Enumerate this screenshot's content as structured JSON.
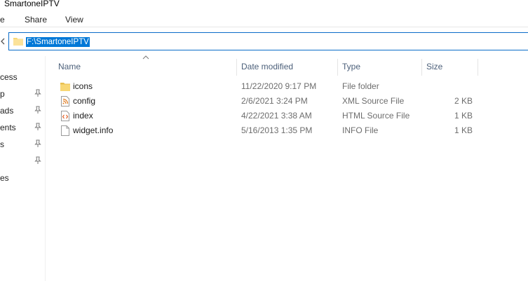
{
  "window": {
    "title": "SmartoneIPTV"
  },
  "ribbon": {
    "tabs": [
      "e",
      "Share",
      "View"
    ]
  },
  "address": {
    "path": "F:\\SmartoneIPTV"
  },
  "nav": {
    "items": [
      {
        "label": "cess",
        "pinned": false
      },
      {
        "label": "p",
        "pinned": true
      },
      {
        "label": "ads",
        "pinned": true
      },
      {
        "label": "ents",
        "pinned": true
      },
      {
        "label": "s",
        "pinned": true
      },
      {
        "label": "",
        "pinned": true
      },
      {
        "label": "es",
        "pinned": false
      }
    ]
  },
  "columns": {
    "name": "Name",
    "date": "Date modified",
    "type": "Type",
    "size": "Size"
  },
  "files": [
    {
      "name": "icons",
      "date": "11/22/2020 9:17 PM",
      "type": "File folder",
      "size": "",
      "icon": "folder-icon"
    },
    {
      "name": "config",
      "date": "2/6/2021 3:24 PM",
      "type": "XML Source File",
      "size": "2 KB",
      "icon": "xml-file-icon"
    },
    {
      "name": "index",
      "date": "4/22/2021 3:38 AM",
      "type": "HTML Source File",
      "size": "1 KB",
      "icon": "html-file-icon"
    },
    {
      "name": "widget.info",
      "date": "5/16/2013 1:35 PM",
      "type": "INFO File",
      "size": "1 KB",
      "icon": "file-icon"
    }
  ],
  "colors": {
    "accent": "#0078d7",
    "folder": "#f8d775",
    "header_text": "#4c607a"
  }
}
